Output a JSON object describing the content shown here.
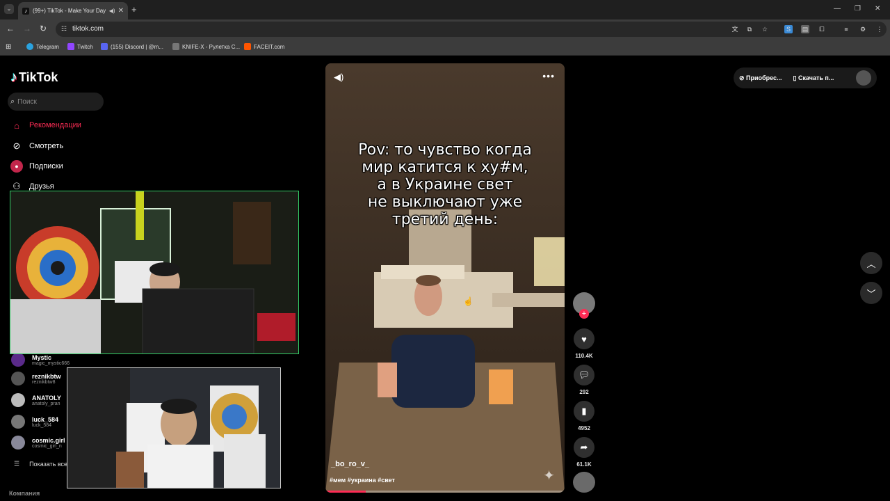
{
  "browser": {
    "tab_title": "(99+) TikTok - Make Your Day",
    "url": "tiktok.com",
    "bookmarks": [
      "Telegram",
      "Twitch",
      "(155) Discord | @m...",
      "KNIFE-X - Рулетка С...",
      "FACEIT.com"
    ]
  },
  "sidebar": {
    "logo": "TikTok",
    "search_placeholder": "Поиск",
    "nav": [
      {
        "label": "Рекомендации",
        "icon": "home-icon",
        "active": true
      },
      {
        "label": "Смотреть",
        "icon": "compass-icon",
        "active": false
      },
      {
        "label": "Подписки",
        "icon": "following-icon",
        "active": false
      },
      {
        "label": "Друзья",
        "icon": "friends-icon",
        "active": false
      }
    ],
    "following": [
      {
        "name": "Mystic",
        "handle": "magic_mystic666"
      },
      {
        "name": "reznikbtw",
        "handle": "reznikbtw8"
      },
      {
        "name": "ANATOLY",
        "handle": "anatoly_pran"
      },
      {
        "name": "luck_584",
        "handle": "luck_584"
      },
      {
        "name": "cosmic.girl",
        "handle": "cosmic_girl_n"
      }
    ],
    "show_all": "Показать все",
    "company": "Компания"
  },
  "video": {
    "caption": "Pov: то чувство когда\nмир катится к ху#м,\nа в Украине свет\nне выключают уже\nтретий день:",
    "author": "_bo_ro_v_",
    "tags": "#мем #украина #свет",
    "progress": 0.17
  },
  "actions": {
    "likes": "110.4K",
    "comments": "292",
    "saves": "4952",
    "shares": "61.1K"
  },
  "header": {
    "get_coins": "Приобрес...",
    "download": "Скачать п..."
  },
  "colors": {
    "accent": "#fe2c55",
    "stream_border": "#33cc66"
  }
}
